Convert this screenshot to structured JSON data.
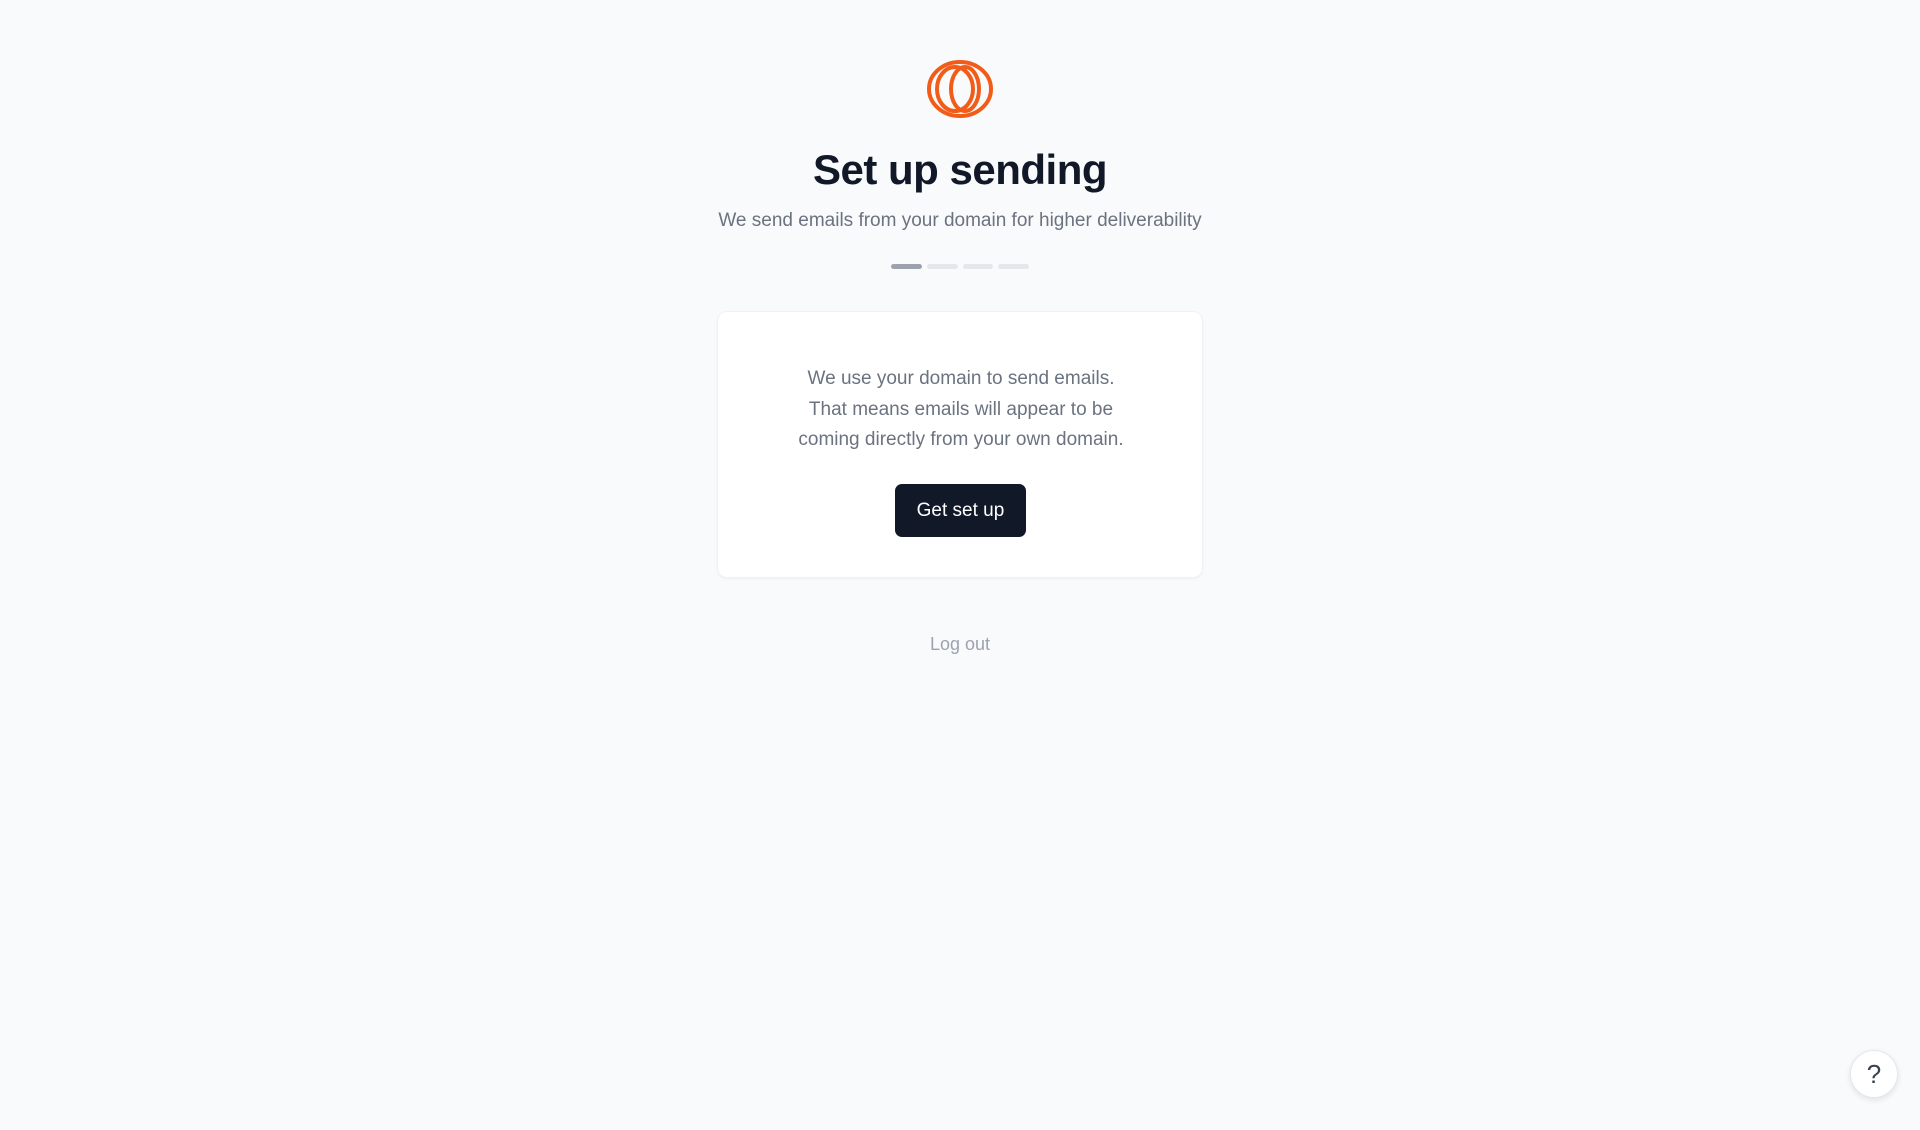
{
  "header": {
    "logo_icon": "orange-ring-logo",
    "title": "Set up sending",
    "subtitle": "We send emails from your domain for higher deliverability"
  },
  "progress": {
    "total_steps": 4,
    "current_step": 1
  },
  "card": {
    "lines": [
      "We use your domain to send emails.",
      "That means emails will appear to be",
      "coming directly from your own domain."
    ],
    "button_label": "Get set up"
  },
  "footer": {
    "logout_label": "Log out"
  },
  "help": {
    "icon": "question-mark-icon",
    "glyph": "?"
  },
  "colors": {
    "brand_orange": "#f25c19",
    "primary_button": "#111827",
    "background": "#f9fafb"
  }
}
